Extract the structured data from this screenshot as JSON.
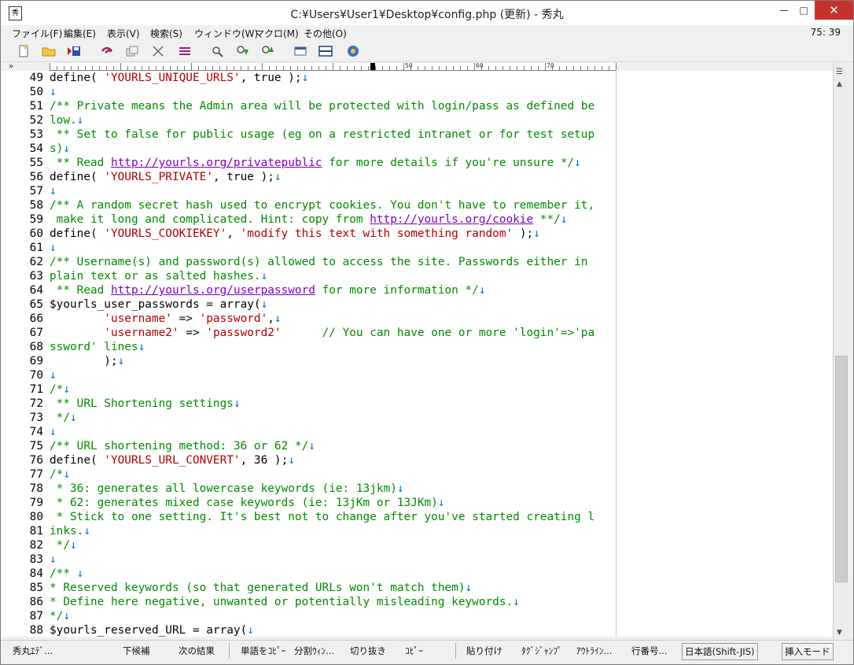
{
  "window": {
    "title": "C:¥Users¥User1¥Desktop¥config.php (更新) - 秀丸",
    "app_icon_glyph": "秀",
    "min_glyph": "—",
    "max_glyph": "□",
    "close_glyph": "✕"
  },
  "menu": {
    "items": [
      "ファイル(F)",
      "編集(E)",
      "表示(V)",
      "検索(S)",
      "ウィンドウ(W)",
      "マクロ(M)",
      "その他(O)"
    ],
    "position": "75: 39"
  },
  "toolbar": {
    "icons": [
      "new-file-icon",
      "open-folder-icon",
      "save-icon",
      "undo-icon",
      "copy-icon",
      "cut-icon",
      "paste-icon",
      "search-icon",
      "search-down-icon",
      "search-up-icon",
      "window-icon",
      "split-window-icon",
      "help-icon"
    ]
  },
  "ruler": {
    "labels": [
      "50",
      "60",
      "70"
    ],
    "collapse_glyph": "»"
  },
  "editor": {
    "lines": [
      {
        "n": "49",
        "segs": [
          {
            "t": "define( ",
            "c": ""
          },
          {
            "t": "'YOURLS_UNIQUE_URLS'",
            "c": "red"
          },
          {
            "t": ", true );",
            "c": ""
          },
          {
            "t": "↓",
            "c": "arrow"
          }
        ]
      },
      {
        "n": "50",
        "segs": [
          {
            "t": "↓",
            "c": "arrow"
          }
        ]
      },
      {
        "n": "51",
        "segs": [
          {
            "t": "/** Private means the Admin area will be protected with login/pass as defined be",
            "c": "green"
          }
        ]
      },
      {
        "n": "52",
        "segs": [
          {
            "t": "low.",
            "c": "green"
          },
          {
            "t": "↓",
            "c": "arrow"
          }
        ]
      },
      {
        "n": "53",
        "segs": [
          {
            "t": " ** Set to false for public usage (eg on a restricted intranet or for test setup",
            "c": "green"
          }
        ]
      },
      {
        "n": "54",
        "segs": [
          {
            "t": "s)",
            "c": "green"
          },
          {
            "t": "↓",
            "c": "arrow"
          }
        ]
      },
      {
        "n": "55",
        "segs": [
          {
            "t": " ** Read ",
            "c": "green"
          },
          {
            "t": "http://yourls.org/privatepublic",
            "c": "link"
          },
          {
            "t": " for more details if you're unsure */",
            "c": "green"
          },
          {
            "t": "↓",
            "c": "arrow"
          }
        ]
      },
      {
        "n": "56",
        "segs": [
          {
            "t": "define( ",
            "c": ""
          },
          {
            "t": "'YOURLS_PRIVATE'",
            "c": "red"
          },
          {
            "t": ", true );",
            "c": ""
          },
          {
            "t": "↓",
            "c": "arrow"
          }
        ]
      },
      {
        "n": "57",
        "segs": [
          {
            "t": "↓",
            "c": "arrow"
          }
        ]
      },
      {
        "n": "58",
        "segs": [
          {
            "t": "/** A random secret hash used to encrypt cookies. You don't have to remember it,",
            "c": "green"
          }
        ]
      },
      {
        "n": "59",
        "segs": [
          {
            "t": " make it long and complicated. Hint: copy from ",
            "c": "green"
          },
          {
            "t": "http://yourls.org/cookie",
            "c": "link"
          },
          {
            "t": " **/",
            "c": "green"
          },
          {
            "t": "↓",
            "c": "arrow"
          }
        ]
      },
      {
        "n": "60",
        "segs": [
          {
            "t": "define( ",
            "c": ""
          },
          {
            "t": "'YOURLS_COOKIEKEY'",
            "c": "red"
          },
          {
            "t": ", ",
            "c": ""
          },
          {
            "t": "'modify this text with something random'",
            "c": "red"
          },
          {
            "t": " );",
            "c": ""
          },
          {
            "t": "↓",
            "c": "arrow"
          }
        ]
      },
      {
        "n": "61",
        "segs": [
          {
            "t": "↓",
            "c": "arrow"
          }
        ]
      },
      {
        "n": "62",
        "segs": [
          {
            "t": "/** Username(s) and password(s) allowed to access the site. Passwords either in",
            "c": "green"
          }
        ]
      },
      {
        "n": "63",
        "segs": [
          {
            "t": "plain text or as salted hashes.",
            "c": "green"
          },
          {
            "t": "↓",
            "c": "arrow"
          }
        ]
      },
      {
        "n": "64",
        "segs": [
          {
            "t": " ** Read ",
            "c": "green"
          },
          {
            "t": "http://yourls.org/userpassword",
            "c": "link"
          },
          {
            "t": " for more information */",
            "c": "green"
          },
          {
            "t": "↓",
            "c": "arrow"
          }
        ]
      },
      {
        "n": "65",
        "segs": [
          {
            "t": "$yourls_user_passwords = array(",
            "c": ""
          },
          {
            "t": "↓",
            "c": "arrow"
          }
        ]
      },
      {
        "n": "66",
        "segs": [
          {
            "t": "        ",
            "c": ""
          },
          {
            "t": "'username'",
            "c": "red"
          },
          {
            "t": " => ",
            "c": ""
          },
          {
            "t": "'password'",
            "c": "red"
          },
          {
            "t": ",",
            "c": ""
          },
          {
            "t": "↓",
            "c": "arrow"
          }
        ]
      },
      {
        "n": "67",
        "segs": [
          {
            "t": "        ",
            "c": ""
          },
          {
            "t": "'username2'",
            "c": "red"
          },
          {
            "t": " => ",
            "c": ""
          },
          {
            "t": "'password2'",
            "c": "red"
          },
          {
            "t": "      // You can have one or more 'login'=>'pa",
            "c": "green"
          }
        ]
      },
      {
        "n": "68",
        "segs": [
          {
            "t": "ssword' lines",
            "c": "green"
          },
          {
            "t": "↓",
            "c": "arrow"
          }
        ]
      },
      {
        "n": "69",
        "segs": [
          {
            "t": "        );",
            "c": ""
          },
          {
            "t": "↓",
            "c": "arrow"
          }
        ]
      },
      {
        "n": "70",
        "segs": [
          {
            "t": "↓",
            "c": "arrow"
          }
        ]
      },
      {
        "n": "71",
        "segs": [
          {
            "t": "/*",
            "c": "green"
          },
          {
            "t": "↓",
            "c": "arrow"
          }
        ]
      },
      {
        "n": "72",
        "segs": [
          {
            "t": " ** URL Shortening settings",
            "c": "green"
          },
          {
            "t": "↓",
            "c": "arrow"
          }
        ]
      },
      {
        "n": "73",
        "segs": [
          {
            "t": " */",
            "c": "green"
          },
          {
            "t": "↓",
            "c": "arrow"
          }
        ]
      },
      {
        "n": "74",
        "segs": [
          {
            "t": "↓",
            "c": "arrow"
          }
        ]
      },
      {
        "n": "75",
        "segs": [
          {
            "t": "/** URL shortening method: 36 or 62 */",
            "c": "green"
          },
          {
            "t": "↓",
            "c": "arrow"
          }
        ]
      },
      {
        "n": "76",
        "segs": [
          {
            "t": "define( ",
            "c": ""
          },
          {
            "t": "'YOURLS_URL_CONVERT'",
            "c": "red"
          },
          {
            "t": ", 36 );",
            "c": ""
          },
          {
            "t": "↓",
            "c": "arrow"
          }
        ]
      },
      {
        "n": "77",
        "segs": [
          {
            "t": "/*",
            "c": "green"
          },
          {
            "t": "↓",
            "c": "arrow"
          }
        ]
      },
      {
        "n": "78",
        "segs": [
          {
            "t": " * 36: generates all lowercase keywords (ie: 13jkm)",
            "c": "green"
          },
          {
            "t": "↓",
            "c": "arrow"
          }
        ]
      },
      {
        "n": "79",
        "segs": [
          {
            "t": " * 62: generates mixed case keywords (ie: 13jKm or 13JKm)",
            "c": "green"
          },
          {
            "t": "↓",
            "c": "arrow"
          }
        ]
      },
      {
        "n": "80",
        "segs": [
          {
            "t": " * Stick to one setting. It's best not to change after you've started creating l",
            "c": "green"
          }
        ]
      },
      {
        "n": "81",
        "segs": [
          {
            "t": "inks.",
            "c": "green"
          },
          {
            "t": "↓",
            "c": "arrow"
          }
        ]
      },
      {
        "n": "82",
        "segs": [
          {
            "t": " */",
            "c": "green"
          },
          {
            "t": "↓",
            "c": "arrow"
          }
        ]
      },
      {
        "n": "83",
        "segs": [
          {
            "t": "↓",
            "c": "arrow"
          }
        ]
      },
      {
        "n": "84",
        "segs": [
          {
            "t": "/** ",
            "c": "green"
          },
          {
            "t": "↓",
            "c": "arrow"
          }
        ]
      },
      {
        "n": "85",
        "segs": [
          {
            "t": "* Reserved keywords (so that generated URLs won't match them)",
            "c": "green"
          },
          {
            "t": "↓",
            "c": "arrow"
          }
        ]
      },
      {
        "n": "86",
        "segs": [
          {
            "t": "* Define here negative, unwanted or potentially misleading keywords.",
            "c": "green"
          },
          {
            "t": "↓",
            "c": "arrow"
          }
        ]
      },
      {
        "n": "87",
        "segs": [
          {
            "t": "*/",
            "c": "green"
          },
          {
            "t": "↓",
            "c": "arrow"
          }
        ]
      },
      {
        "n": "88",
        "segs": [
          {
            "t": "$yourls_reserved_URL = array(",
            "c": ""
          },
          {
            "t": "↓",
            "c": "arrow"
          }
        ]
      }
    ]
  },
  "scrollbar": {
    "split_glyph": "☰",
    "up_glyph": "▲",
    "down_glyph": "▼",
    "position": 0.51
  },
  "status": {
    "editor_name": "秀丸ｴﾃﾞ...",
    "items": [
      "下候補",
      "次の結果",
      "単語をｺﾋﾟｰ",
      "分割ｳｨﾝ...",
      "切り抜き",
      "ｺﾋﾟｰ",
      "貼り付け",
      "ﾀｸﾞｼﾞｬﾝﾌﾟ",
      "ｱｳﾄﾗｲﾝ...",
      "行番号..."
    ],
    "encoding": "日本語(Shift-JIS)",
    "mode": "挿入モード"
  },
  "colors": {
    "comment": "#008a00",
    "string": "#b00000",
    "link": "#8000c0",
    "newline_mark": "#0070c0",
    "close_button": "#c7312d"
  }
}
